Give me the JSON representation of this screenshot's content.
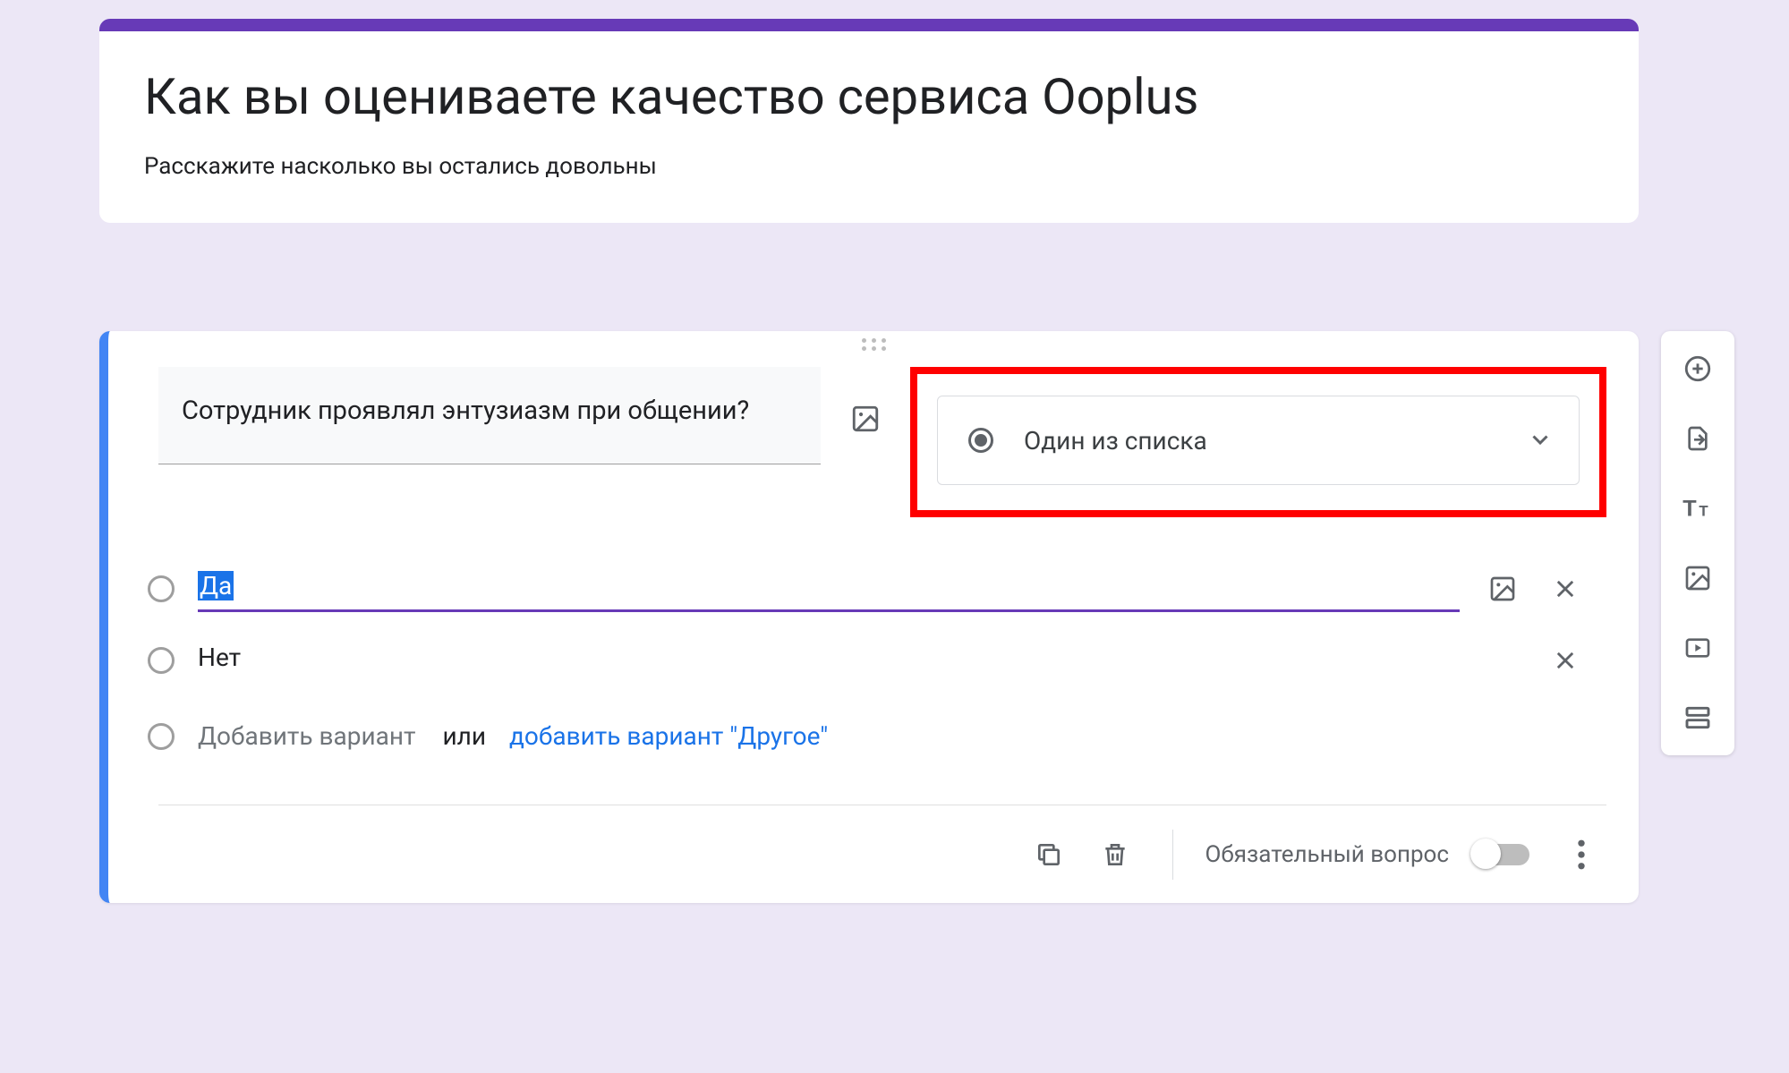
{
  "header": {
    "title": "Как вы оцениваете качество сервиса Ooplus",
    "description": "Расскажите насколько вы остались довольны"
  },
  "question": {
    "text": "Сотрудник проявлял энтузиазм при общении?",
    "type_label": "Один из списка",
    "options": [
      {
        "label": "Да",
        "focused": true
      },
      {
        "label": "Нет",
        "focused": false
      }
    ],
    "add_option_placeholder": "Добавить вариант",
    "add_or": "или",
    "add_other": "добавить вариант \"Другое\""
  },
  "footer": {
    "required_label": "Обязательный вопрос",
    "required_on": false
  },
  "toolbar_icons": {
    "add_question": "add-circle-icon",
    "import_questions": "import-icon",
    "add_title": "title-icon",
    "add_image": "image-icon",
    "add_video": "video-icon",
    "add_section": "section-icon"
  }
}
